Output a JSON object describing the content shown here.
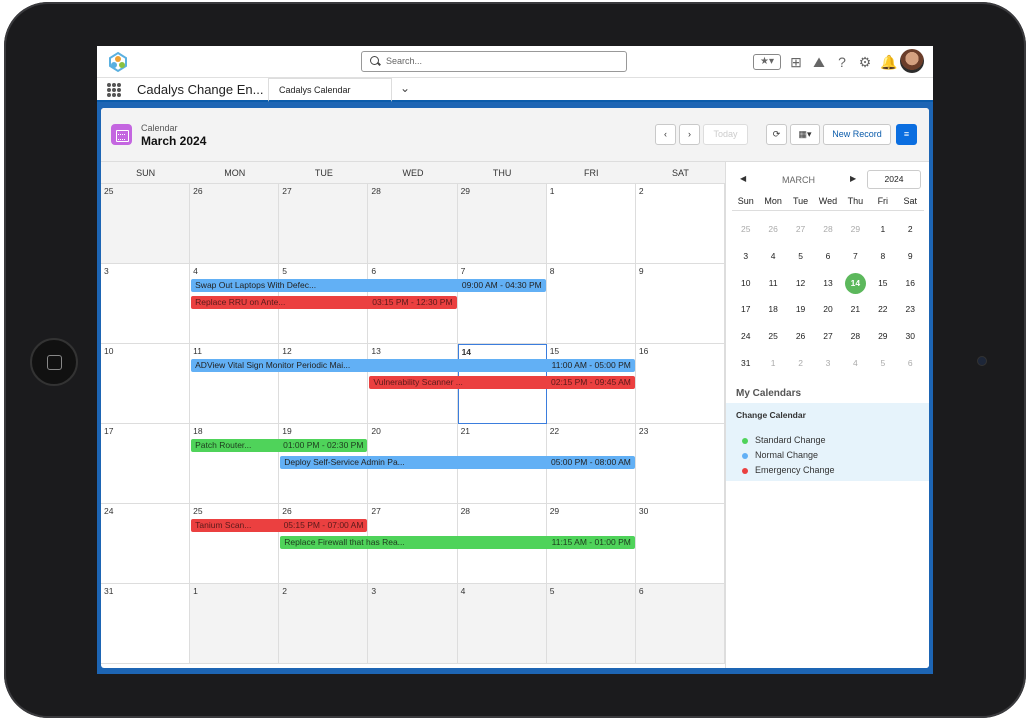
{
  "app": {
    "search_placeholder": "Search...",
    "app_name": "Cadalys Change En...",
    "active_tab": "Cadalys Calendar"
  },
  "calendar": {
    "label": "Calendar",
    "title": "March 2024",
    "today_label": "Today",
    "new_record_label": "New Record",
    "weekdays": [
      "SUN",
      "MON",
      "TUE",
      "WED",
      "THU",
      "FRI",
      "SAT"
    ],
    "weeks": [
      [
        "25",
        "26",
        "27",
        "28",
        "29",
        "1",
        "2"
      ],
      [
        "3",
        "4",
        "5",
        "6",
        "7",
        "8",
        "9"
      ],
      [
        "10",
        "11",
        "12",
        "13",
        "14",
        "15",
        "16"
      ],
      [
        "17",
        "18",
        "19",
        "20",
        "21",
        "22",
        "23"
      ],
      [
        "24",
        "25",
        "26",
        "27",
        "28",
        "29",
        "30"
      ],
      [
        "31",
        "1",
        "2",
        "3",
        "4",
        "5",
        "6"
      ]
    ],
    "events": [
      {
        "title": "Swap Out Laptops With Defec...",
        "time": "09:00 AM - 04:30 PM",
        "color": "blue"
      },
      {
        "title": "Replace RRU on Ante...",
        "time": "03:15 PM - 12:30 PM",
        "color": "red"
      },
      {
        "title": "ADView Vital Sign Monitor Periodic Mai...",
        "time": "11:00 AM - 05:00 PM",
        "color": "blue"
      },
      {
        "title": "Vulnerability Scanner ...",
        "time": "02:15 PM - 09:45 AM",
        "color": "red"
      },
      {
        "title": "Patch Router...",
        "time": "01:00 PM - 02:30 PM",
        "color": "green"
      },
      {
        "title": "Deploy Self-Service Admin Pa...",
        "time": "05:00 PM - 08:00 AM",
        "color": "blue"
      },
      {
        "title": "Tanium Scan...",
        "time": "05:15 PM - 07:00 AM",
        "color": "red"
      },
      {
        "title": "Replace Firewall that has Rea...",
        "time": "11:15 AM - 01:00 PM",
        "color": "green"
      }
    ]
  },
  "mini_calendar": {
    "month": "MARCH",
    "year": "2024",
    "weekdays": [
      "Sun",
      "Mon",
      "Tue",
      "Wed",
      "Thu",
      "Fri",
      "Sat"
    ],
    "weeks": [
      [
        "25",
        "26",
        "27",
        "28",
        "29",
        "1",
        "2"
      ],
      [
        "3",
        "4",
        "5",
        "6",
        "7",
        "8",
        "9"
      ],
      [
        "10",
        "11",
        "12",
        "13",
        "14",
        "15",
        "16"
      ],
      [
        "17",
        "18",
        "19",
        "20",
        "21",
        "22",
        "23"
      ],
      [
        "24",
        "25",
        "26",
        "27",
        "28",
        "29",
        "30"
      ],
      [
        "31",
        "1",
        "2",
        "3",
        "4",
        "5",
        "6"
      ]
    ],
    "selected": "14"
  },
  "my_calendars": {
    "title": "My Calendars",
    "calendar_name": "Change Calendar",
    "legend": [
      {
        "label": "Standard Change",
        "color": "#4fd35a"
      },
      {
        "label": "Normal Change",
        "color": "#62b0f5"
      },
      {
        "label": "Emergency Change",
        "color": "#eb4040"
      }
    ]
  }
}
